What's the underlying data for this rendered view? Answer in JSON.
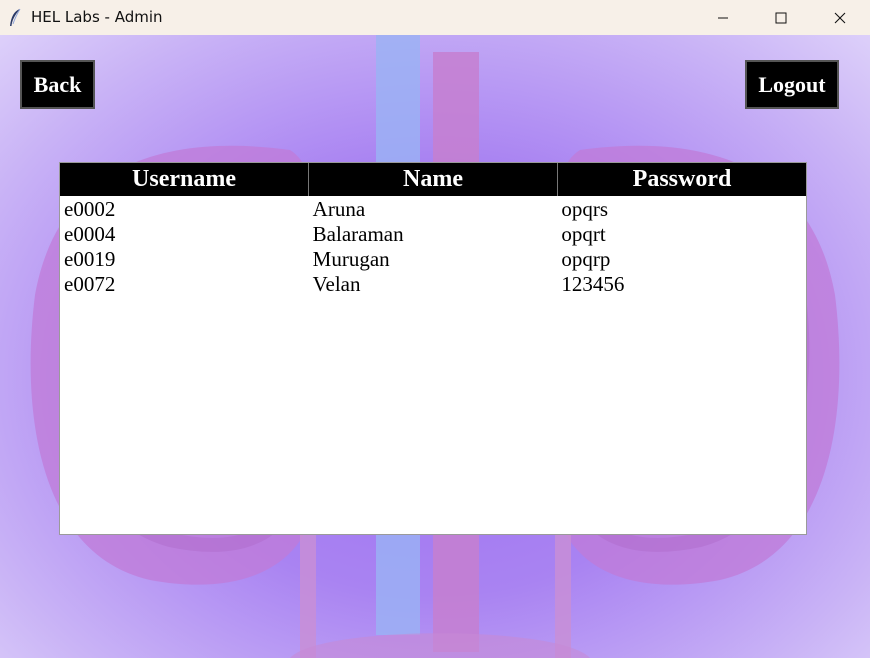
{
  "window": {
    "title": "HEL Labs - Admin",
    "icon": "feather-icon",
    "controls": [
      "minimize-icon",
      "maximize-icon",
      "close-icon"
    ]
  },
  "toolbar": {
    "back_label": "Back",
    "logout_label": "Logout"
  },
  "table": {
    "columns": [
      "Username",
      "Name",
      "Password"
    ],
    "rows": [
      [
        "e0002",
        "Aruna",
        "opqrs"
      ],
      [
        "e0004",
        "Balaraman",
        "opqrt"
      ],
      [
        "e0019",
        "Murugan",
        "opqrp"
      ],
      [
        "e0072",
        "Velan",
        "123456"
      ]
    ]
  },
  "colors": {
    "titlebar": "#f7f0e8",
    "background_primary": "#a983f2",
    "button_bg": "#000000",
    "header_bg": "#000000"
  }
}
